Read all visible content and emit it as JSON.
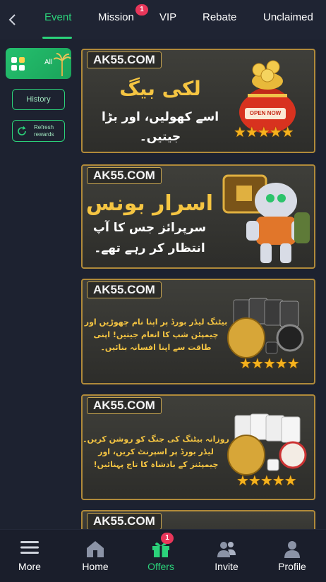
{
  "header": {
    "back_icon": "chevron-left-icon",
    "tabs": [
      {
        "label": "Event",
        "active": true
      },
      {
        "label": "Mission",
        "badge": "1"
      },
      {
        "label": "VIP"
      },
      {
        "label": "Rebate"
      },
      {
        "label": "Unclaimed"
      }
    ]
  },
  "sidebar": {
    "all_label": "All",
    "history_label": "History",
    "refresh_label_line1": "Refresh",
    "refresh_label_line2": "rewards"
  },
  "banners": [
    {
      "brand": "AK55.COM",
      "title": "لکی بیگ",
      "body_line1": "اسے کھولیں، اور بڑا",
      "body_line2": "جیتیں۔",
      "badge": "OPEN NOW"
    },
    {
      "brand": "AK55.COM",
      "title": "اسرار بونس",
      "body_line1": "سرپرائز جس کا آپ",
      "body_line2": "انتظار کر رہے تھے۔"
    },
    {
      "brand": "AK55.COM",
      "body_line1": "بیٹنگ لیڈر بورڈ پر اپنا نام چھوڑیں اور",
      "body_line2": "چیمپئن شپ کا انعام جیتیں! اپنی",
      "body_line3": "طاقت سے اپنا افسانہ بنائیں۔"
    },
    {
      "brand": "AK55.COM",
      "body_line1": "روزانہ بیٹنگ کی جنگ کو روشن کریں۔",
      "body_line2": "لیڈر بورڈ پر اسپرنٹ کریں، اور",
      "body_line3": "چیمپئنز کے بادشاہ کا تاج پہنائیں!"
    },
    {
      "brand": "AK55.COM"
    }
  ],
  "bottom_nav": [
    {
      "label": "More",
      "icon": "menu-icon"
    },
    {
      "label": "Home",
      "icon": "home-icon"
    },
    {
      "label": "Offers",
      "icon": "gift-icon",
      "badge": "1",
      "active": true
    },
    {
      "label": "Invite",
      "icon": "users-icon"
    },
    {
      "label": "Profile",
      "icon": "user-icon"
    }
  ],
  "colors": {
    "accent": "#2bd27a",
    "badge": "#e8365a",
    "gold": "#f5c542",
    "background": "#1d2230"
  }
}
